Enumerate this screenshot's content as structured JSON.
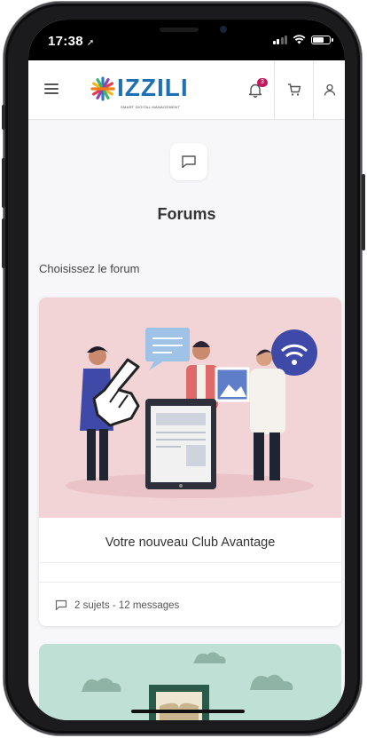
{
  "status_bar": {
    "time": "17:38",
    "location_arrow_icon": "location-arrow-icon",
    "signal_icon": "cellular-signal-icon",
    "wifi_icon": "wifi-icon",
    "battery_icon": "battery-icon",
    "battery_level": 0.75
  },
  "app_bar": {
    "menu_icon": "hamburger-menu-icon",
    "logo": {
      "name": "IZZILI",
      "tagline": "SMART DIGITAL MANAGEMENT",
      "star_colors": [
        "#2e7bc4",
        "#f2b51e",
        "#e53a4b",
        "#3db36b",
        "#8e44ad",
        "#ef7d1a"
      ]
    },
    "notification_icon": "bell-icon",
    "notification_count": "3",
    "cart_icon": "cart-icon",
    "profile_icon": "user-icon",
    "accent_color": "#1f6fb5",
    "badge_color": "#c2185b"
  },
  "page": {
    "header_icon": "chat-bubble-icon",
    "title": "Forums",
    "subtitle": "Choisissez le forum"
  },
  "forums": [
    {
      "title": "Votre nouveau Club Avantage",
      "stats": "2 sujets - 12 messages",
      "stats_icon": "chat-bubble-icon",
      "image_bg": "#f2d4d7"
    },
    {
      "title": "",
      "stats": "",
      "image_bg": "#bfe0d4"
    }
  ],
  "overlay": {
    "pointer_icon": "hand-pointer-icon"
  }
}
